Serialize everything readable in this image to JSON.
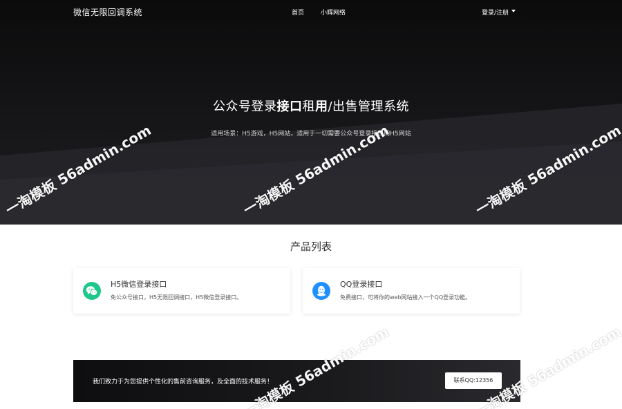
{
  "nav": {
    "brand": "微信无限回调系统",
    "links": [
      "首页",
      "小辉网络"
    ],
    "login": "登录/注册"
  },
  "hero": {
    "title_part1": "公众号登录",
    "title_bold1": "接口",
    "title_part2": "租",
    "title_bold2": "用",
    "title_part3": "/出售管理系统",
    "subtitle": "适用场景：H5游戏，H5网站，适用于一切需要公众号登录接口的H5网站"
  },
  "products": {
    "title": "产品列表",
    "items": [
      {
        "title": "H5微信登录接口",
        "desc": "免公众号接口，H5无限回调接口，H5微信登录接口。",
        "icon": "wechat-icon",
        "color": "#1ec78a"
      },
      {
        "title": "QQ登录接口",
        "desc": "免费接口，可将你的web网站接入一个QQ登录功能。",
        "icon": "qq-icon",
        "color": "#1e90ff"
      }
    ]
  },
  "cta": {
    "text": "我们致力于为您提供个性化的售前咨询服务，及全面的技术服务！",
    "button": "联系QQ:12356"
  },
  "watermark": "一淘模板 56admin.com"
}
